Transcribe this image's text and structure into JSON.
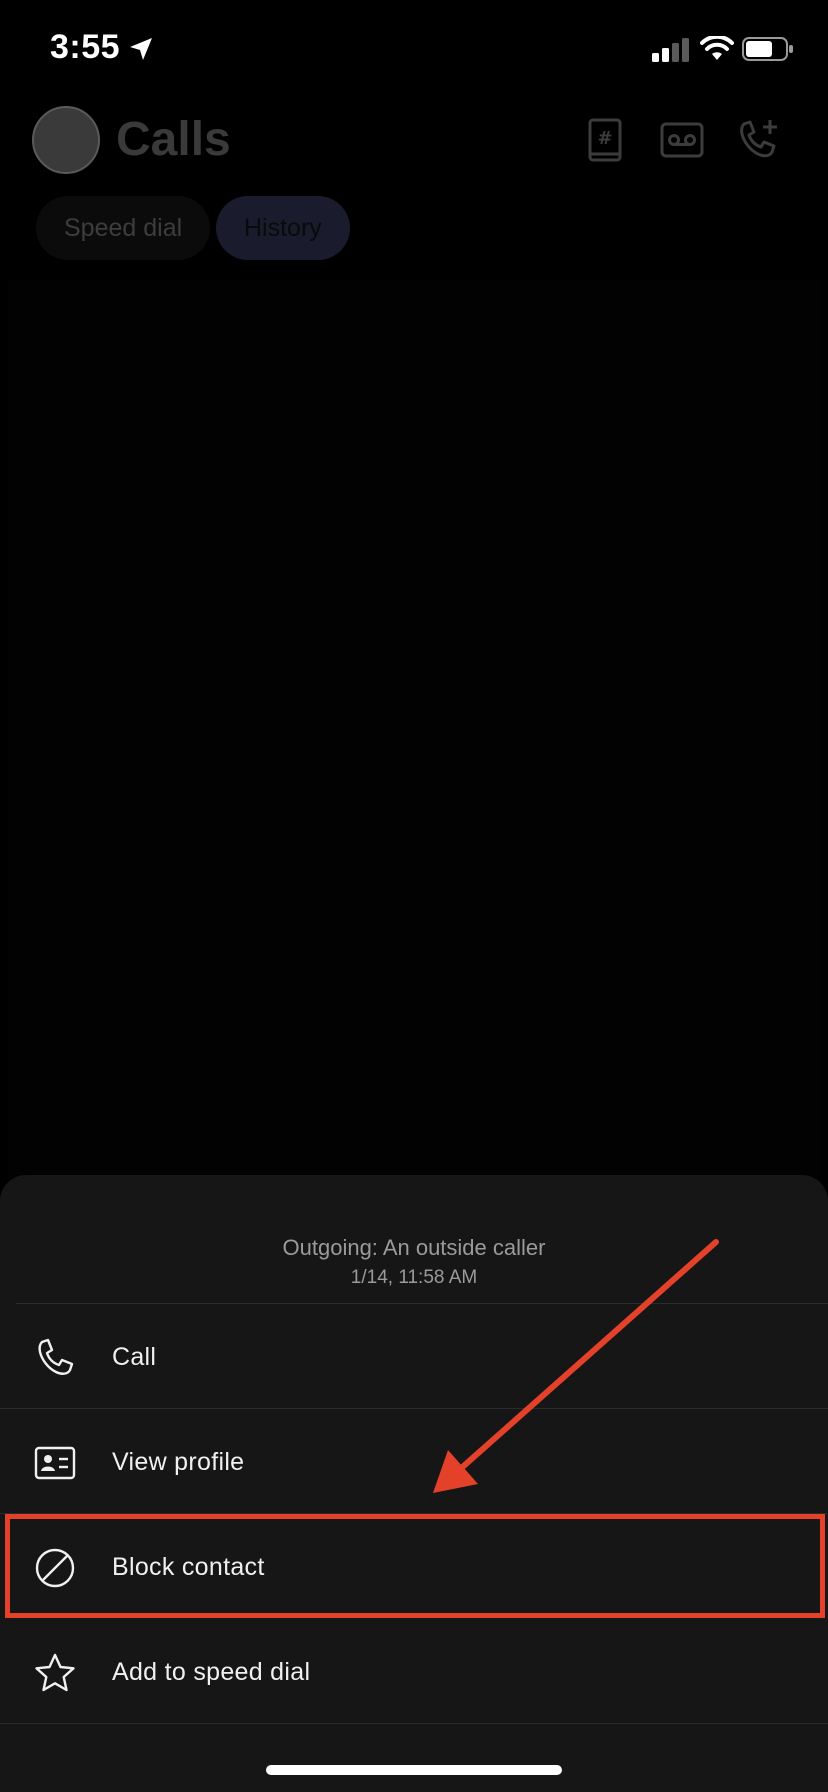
{
  "status_bar": {
    "time": "3:55",
    "icons": [
      "location-arrow-icon",
      "cellular-signal-icon",
      "wifi-icon",
      "battery-icon"
    ]
  },
  "header": {
    "title": "Calls",
    "icons": [
      "dialpad-icon",
      "voicemail-icon",
      "add-call-icon"
    ]
  },
  "tabs": [
    {
      "label": "Speed dial",
      "selected": false
    },
    {
      "label": "History",
      "selected": true
    }
  ],
  "sheet": {
    "title": "Outgoing: An outside caller",
    "subtitle": "1/14, 11:58 AM",
    "actions": [
      {
        "label": "Call",
        "icon": "phone-icon"
      },
      {
        "label": "View profile",
        "icon": "contact-card-icon"
      },
      {
        "label": "Block contact",
        "icon": "block-icon"
      },
      {
        "label": "Add to speed dial",
        "icon": "star-icon"
      }
    ]
  },
  "annotation": {
    "color": "#e4412b",
    "highlighted_action": "Block contact"
  }
}
